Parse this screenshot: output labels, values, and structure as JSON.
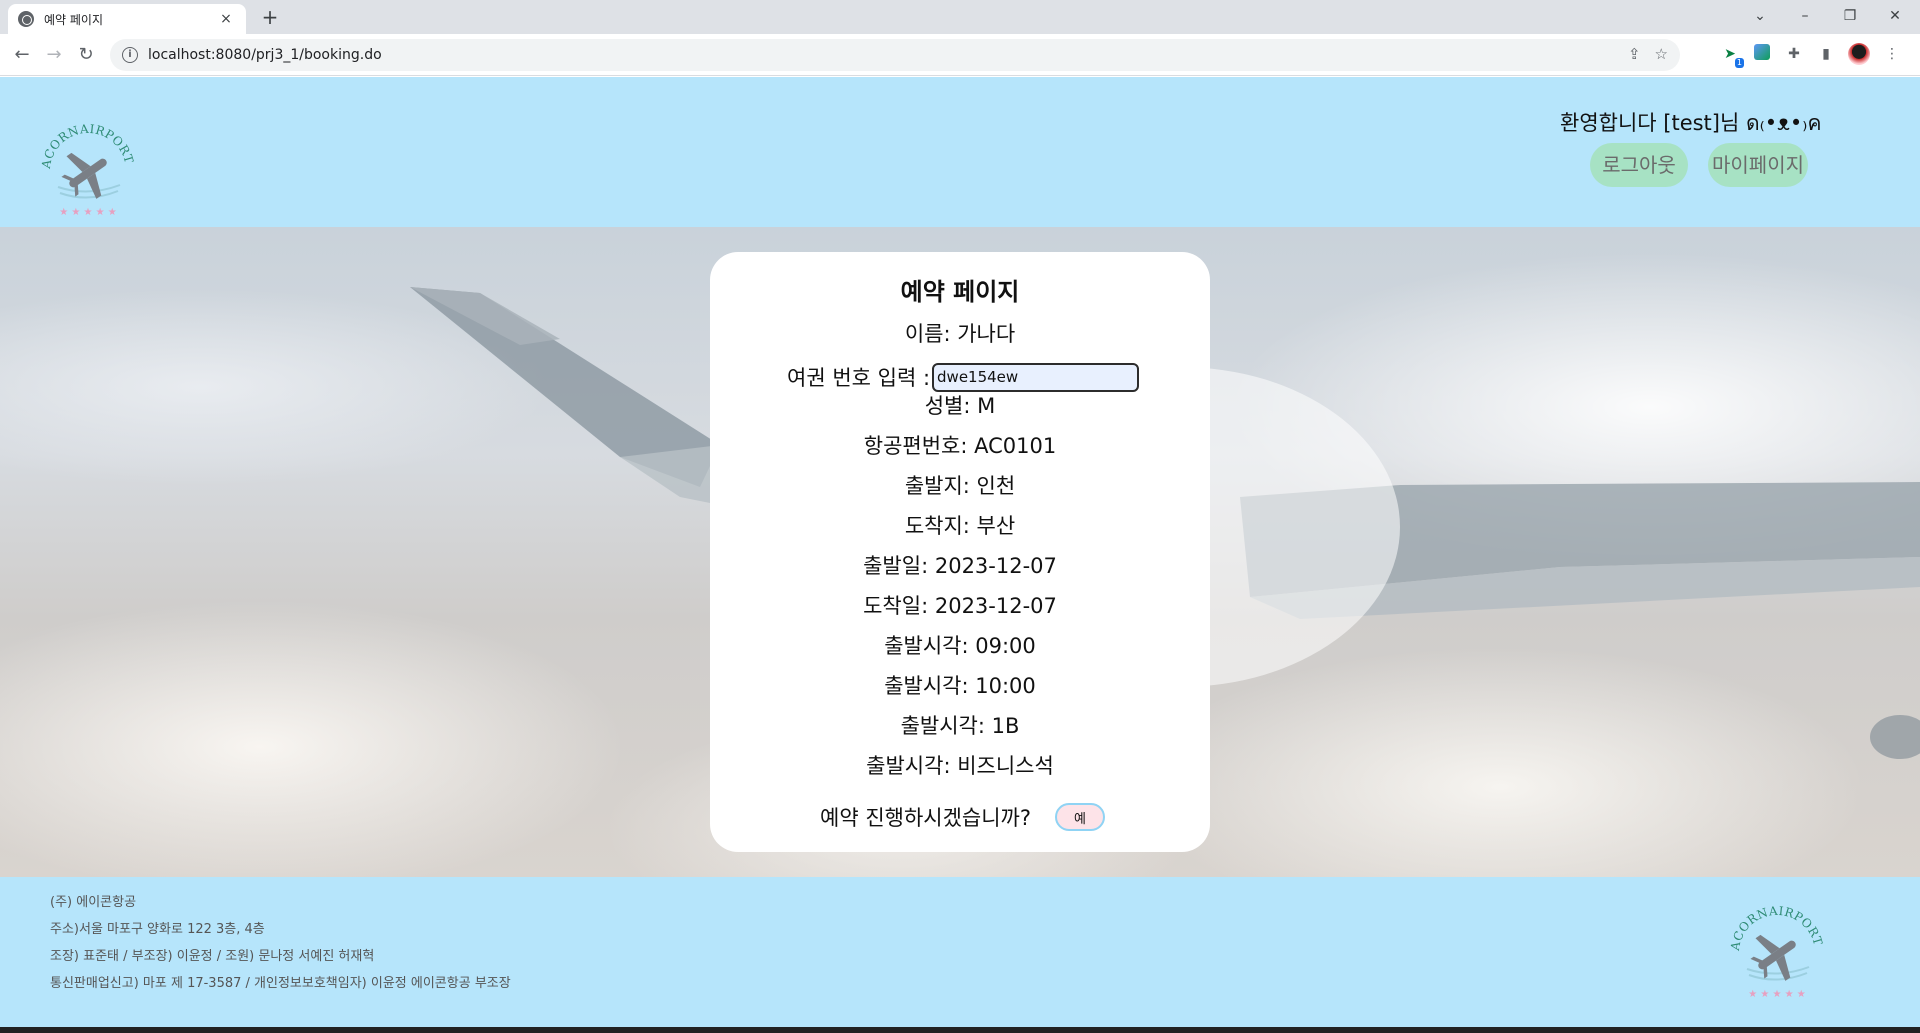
{
  "browser": {
    "tab_title": "예약 페이지",
    "tab_close": "×",
    "new_tab": "+",
    "url": "localhost:8080/prj3_1/booking.do",
    "window_controls": [
      "⌄",
      "–",
      "❐",
      "✕"
    ]
  },
  "header": {
    "logo_text": "ACORNAIRPORT",
    "welcome": "환영합니다 [test]님 ด₍•ᴥ•₎ค",
    "logout_label": "로그아웃",
    "mypage_label": "마이페이지"
  },
  "booking": {
    "title": "예약 페이지",
    "name_label": "이름",
    "name_value": "가나다",
    "passport_label": "여권 번호 입력 :",
    "passport_value": "dwe154ew",
    "gender_label": "성별",
    "gender_value": "M",
    "flight_label": "항공편번호",
    "flight_value": "AC0101",
    "depart_place_label": "출발지",
    "depart_place_value": "인천",
    "arrive_place_label": "도착지",
    "arrive_place_value": "부산",
    "depart_date_label": "출발일",
    "depart_date_value": "2023-12-07",
    "arrive_date_label": "도착일",
    "arrive_date_value": "2023-12-07",
    "depart_time_label": "출발시각",
    "depart_time_value": "09:00",
    "time2_label": "출발시각",
    "time2_value": "10:00",
    "seat_label": "출발시각",
    "seat_value": "1B",
    "class_label": "출발시각",
    "class_value": "비즈니스석",
    "confirm_question": "예약 진행하시겠습니까?",
    "confirm_button": "예"
  },
  "footer": {
    "company": "(주) 에이콘항공",
    "address": "주소)서울 마포구 양화로 122 3층, 4층",
    "members": "조장) 표준태 / 부조장) 이윤정 / 조원) 문나정 서예진 허재혁",
    "registration": "통신판매업신고) 마포 제 17-3587 / 개인정보보호책임자) 이윤정 에이콘항공 부조장"
  },
  "colors": {
    "header_bg": "#b6e5fb",
    "header_button": "#a7e2c4",
    "logo_green": "#2e8b74",
    "plane_gray": "#7a7f86"
  }
}
